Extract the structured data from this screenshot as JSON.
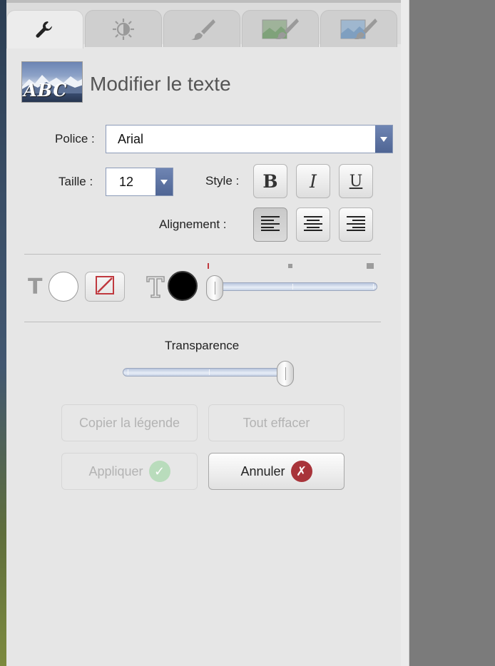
{
  "tabs": [
    {
      "icon": "wrench-icon",
      "active": true
    },
    {
      "icon": "brightness-icon",
      "active": false
    },
    {
      "icon": "brush-icon",
      "active": false
    },
    {
      "icon": "image-brush-icon",
      "active": false
    },
    {
      "icon": "image-brush-blue-icon",
      "active": false
    }
  ],
  "header": {
    "thumbnail_text": "ABC",
    "title": "Modifier le texte"
  },
  "font": {
    "label": "Police :",
    "value": "Arial"
  },
  "size": {
    "label": "Taille :",
    "value": "12"
  },
  "style": {
    "label": "Style :",
    "bold": "B",
    "italic": "I",
    "underline": "U"
  },
  "alignment": {
    "label": "Alignement :",
    "selected": "left"
  },
  "colors": {
    "text_color": "#000000",
    "background_color": "#ffffff",
    "accent": "#c0393f",
    "slider_level": 0
  },
  "transparency": {
    "label": "Transparence",
    "level": 1.0
  },
  "actions": {
    "copy_caption": "Copier la légende",
    "clear_all": "Tout effacer",
    "apply": "Appliquer",
    "cancel": "Annuler"
  }
}
